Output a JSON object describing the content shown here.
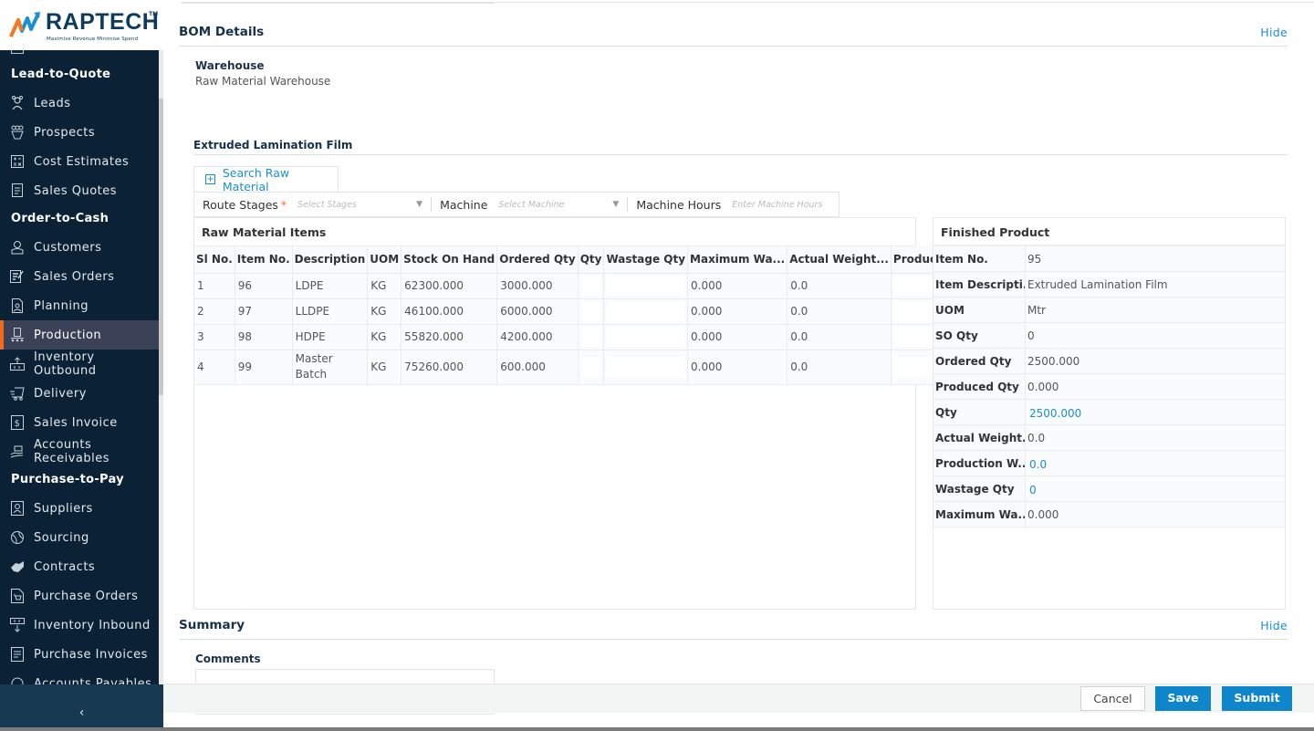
{
  "brand": {
    "name": "RAPTECH",
    "trademark": "TM",
    "tagline": "Maximise Revenue Minimise Spend"
  },
  "sidebar": {
    "groups": [
      {
        "title": "Lead-to-Quote",
        "items": [
          {
            "label": "Leads",
            "icon": "leads-icon"
          },
          {
            "label": "Prospects",
            "icon": "prospects-icon"
          },
          {
            "label": "Cost Estimates",
            "icon": "calculator-icon"
          },
          {
            "label": "Sales Quotes",
            "icon": "quote-document-icon"
          }
        ]
      },
      {
        "title": "Order-to-Cash",
        "items": [
          {
            "label": "Customers",
            "icon": "customer-icon"
          },
          {
            "label": "Sales Orders",
            "icon": "sales-order-icon"
          },
          {
            "label": "Planning",
            "icon": "planning-icon"
          },
          {
            "label": "Production",
            "icon": "production-icon",
            "active": true
          },
          {
            "label": "Inventory Outbound",
            "icon": "inventory-outbound-icon"
          },
          {
            "label": "Delivery",
            "icon": "delivery-truck-icon"
          },
          {
            "label": "Sales Invoice",
            "icon": "invoice-dollar-icon"
          },
          {
            "label": "Accounts Receivables",
            "icon": "receivables-hand-icon"
          }
        ]
      },
      {
        "title": "Purchase-to-Pay",
        "items": [
          {
            "label": "Suppliers",
            "icon": "supplier-icon"
          },
          {
            "label": "Sourcing",
            "icon": "sourcing-globe-icon"
          },
          {
            "label": "Contracts",
            "icon": "handshake-icon"
          },
          {
            "label": "Purchase Orders",
            "icon": "cart-document-icon"
          },
          {
            "label": "Inventory Inbound",
            "icon": "inventory-inbound-icon"
          },
          {
            "label": "Purchase Invoices",
            "icon": "purchase-invoice-icon"
          },
          {
            "label": "Accounts Payables",
            "icon": "payables-icon"
          }
        ]
      }
    ],
    "collapse_icon": "chevron-left-icon",
    "collapse_glyph": "‹"
  },
  "bom": {
    "title": "BOM Details",
    "hide_label": "Hide",
    "warehouse_label": "Warehouse",
    "warehouse_value": "Raw Material Warehouse",
    "product_heading": "Extruded Lamination Film",
    "search_button": "Search Raw Material",
    "filters": {
      "route_stages_label": "Route Stages",
      "required_mark": "*",
      "route_stages_placeholder": "Select Stages",
      "machine_label": "Machine",
      "machine_placeholder": "Select Machine",
      "machine_hours_label": "Machine Hours",
      "machine_hours_placeholder": "Enter Machine Hours"
    },
    "raw_materials": {
      "title": "Raw Material Items",
      "columns": [
        "Sl No.",
        "Item No.",
        "Description",
        "UOM",
        "Stock On Hand",
        "Ordered Qty",
        "Qty",
        "Wastage Qty",
        "Maximum Wa...",
        "Actual Weight...",
        "Production W...",
        ""
      ],
      "rows": [
        {
          "sl": "1",
          "item_no": "96",
          "description": "LDPE",
          "uom": "KG",
          "stock": "62300.000",
          "ordered": "3000.000",
          "qty": "",
          "wastage": "",
          "max_wastage": "0.000",
          "actual_weight": "0.0",
          "production_weight": ""
        },
        {
          "sl": "2",
          "item_no": "97",
          "description": "LLDPE",
          "uom": "KG",
          "stock": "46100.000",
          "ordered": "6000.000",
          "qty": "",
          "wastage": "",
          "max_wastage": "0.000",
          "actual_weight": "0.0",
          "production_weight": ""
        },
        {
          "sl": "3",
          "item_no": "98",
          "description": "HDPE",
          "uom": "KG",
          "stock": "55820.000",
          "ordered": "4200.000",
          "qty": "",
          "wastage": "",
          "max_wastage": "0.000",
          "actual_weight": "0.0",
          "production_weight": ""
        },
        {
          "sl": "4",
          "item_no": "99",
          "description": "Master Batch",
          "uom": "KG",
          "stock": "75260.000",
          "ordered": "600.000",
          "qty": "",
          "wastage": "",
          "max_wastage": "0.000",
          "actual_weight": "0.0",
          "production_weight": ""
        }
      ]
    },
    "finished_product": {
      "title": "Finished Product",
      "rows": [
        {
          "label": "Item No.",
          "value": "95",
          "editable": false
        },
        {
          "label": "Item Descripti...",
          "value": "Extruded Lamination Film",
          "editable": false
        },
        {
          "label": "UOM",
          "value": "Mtr",
          "editable": false
        },
        {
          "label": "SO Qty",
          "value": "0",
          "editable": false
        },
        {
          "label": "Ordered Qty",
          "value": "2500.000",
          "editable": false
        },
        {
          "label": "Produced Qty",
          "value": "0.000",
          "editable": false
        },
        {
          "label": "Qty",
          "value": "2500.000",
          "editable": true
        },
        {
          "label": "Actual Weight...",
          "value": "0.0",
          "editable": false
        },
        {
          "label": "Production W...",
          "value": "0.0",
          "editable": true
        },
        {
          "label": "Wastage Qty",
          "value": "0",
          "editable": true
        },
        {
          "label": "Maximum Wa...",
          "value": "0.000",
          "editable": false
        }
      ]
    }
  },
  "summary": {
    "title": "Summary",
    "hide_label": "Hide",
    "comments_label": "Comments",
    "comments_value": ""
  },
  "actions": {
    "cancel": "Cancel",
    "save": "Save",
    "submit": "Submit"
  },
  "colors": {
    "sidebar_bg": "#0b2236",
    "active_item_bg": "#3b4257",
    "active_accent": "#f26b1d",
    "link_blue": "#1a8fcf",
    "primary_button": "#0f86cc"
  }
}
